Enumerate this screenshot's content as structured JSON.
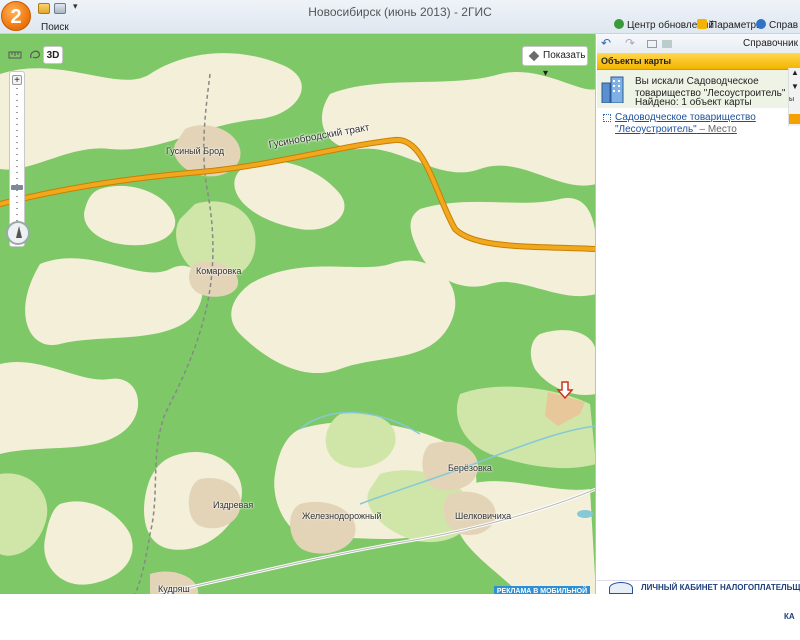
{
  "titlebar": {
    "logo": "2",
    "quick_access_menu": "▾",
    "title": "Новосибирск (июнь 2013) - 2ГИС",
    "search_tab": "Поиск",
    "update_center": "Центр обновлений",
    "parameters": "Параметры",
    "help": "Справ"
  },
  "map": {
    "tool_3d": "3D",
    "show_button": "Показать",
    "zoom_plus": "+",
    "zoom_minus": "−",
    "zoom_level": 0.3,
    "road_label": "Гусинобродский тракт",
    "places": {
      "gusiny_brod": "Гусиный Брод",
      "komarovka": "Комаровка",
      "beryozovka": "Берёзовка",
      "izdrevaya": "Издревая",
      "zheleznodorozhny": "Железнодорожный",
      "shelkovichikha": "Шелковичиха",
      "kudryash": "Кудряш"
    },
    "ad_banner": "РЕКЛАМА В МОБИЛЬНОЙ"
  },
  "panel": {
    "back": "↶",
    "forward": "↷",
    "spravochnik": "Справочник",
    "header": "Объекты карты",
    "search_query": "Вы искали Садоводческое товарищество \"Лесоустроитель\"",
    "search_found": "Найдено: 1 объект карты",
    "result_name": "Садоводческое товарищество \"Лесоустроитель\"",
    "result_type": " – Место",
    "side_btn_a": "▲",
    "side_btn_b": "▼",
    "side_btn_c": "ы",
    "tax_banner": "ЛИЧНЫЙ КАБИНЕТ НАЛОГОПЛАТЕЛЬЩИ",
    "tax_banner_tail": "КА"
  },
  "colors": {
    "forest": "#7fc867",
    "open_land": "#f4efd9",
    "light_meadow": "#cfe6a8",
    "road": "#f2a81e",
    "settlement": "#e3d4b8",
    "panel_header": "#f4b400",
    "marker": "#d0301e"
  }
}
